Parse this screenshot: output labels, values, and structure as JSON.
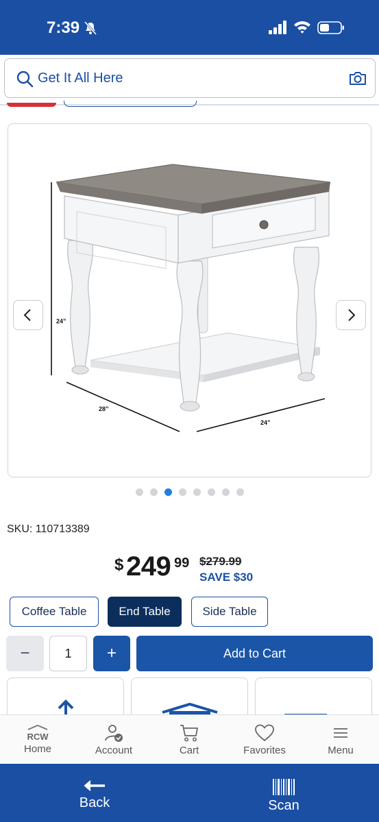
{
  "status_bar": {
    "time": "7:39"
  },
  "search": {
    "placeholder": "Get It All Here"
  },
  "product": {
    "sku_label": "SKU: 110713389",
    "dimensions": {
      "height": "24”",
      "depth": "28”",
      "width": "24”"
    },
    "carousel": {
      "total": 8,
      "active_index": 2
    },
    "price": {
      "currency": "$",
      "whole": "249",
      "cents": "99",
      "was": "$279.99",
      "save": "SAVE $30"
    }
  },
  "variants": [
    {
      "label": "Coffee Table",
      "selected": false
    },
    {
      "label": "End Table",
      "selected": true
    },
    {
      "label": "Side Table",
      "selected": false
    }
  ],
  "quantity": {
    "minus_label": "−",
    "value": "1",
    "plus_label": "+",
    "add_to_cart": "Add to Cart"
  },
  "app_nav": {
    "home_logo": "RCW",
    "items": [
      {
        "label": "Home",
        "icon": "home-icon"
      },
      {
        "label": "Account",
        "icon": "account-icon"
      },
      {
        "label": "Cart",
        "icon": "cart-icon"
      },
      {
        "label": "Favorites",
        "icon": "heart-icon"
      },
      {
        "label": "Menu",
        "icon": "menu-icon"
      }
    ]
  },
  "action_bar": {
    "back_label": "Back",
    "scan_label": "Scan"
  },
  "colors": {
    "brand_blue": "#1a4fa3",
    "button_blue": "#1a55a8",
    "selected_variant": "#0b2e5c",
    "active_dot": "#1e80e0"
  }
}
